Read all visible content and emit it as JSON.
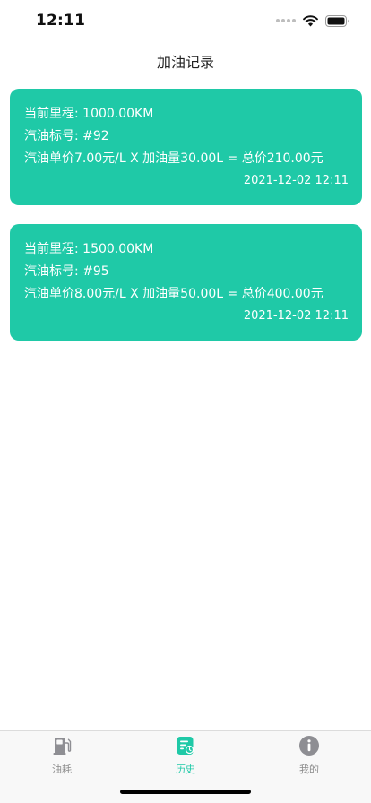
{
  "status_bar": {
    "time": "12:11"
  },
  "nav": {
    "title": "加油记录"
  },
  "records": [
    {
      "mileage": "当前里程: 1000.00KM",
      "fuel_grade": "汽油标号: #92",
      "calc": "汽油单价7.00元/L X 加油量30.00L = 总价210.00元",
      "time": "2021-12-02 12:11"
    },
    {
      "mileage": "当前里程: 1500.00KM",
      "fuel_grade": "汽油标号: #95",
      "calc": "汽油单价8.00元/L X 加油量50.00L = 总价400.00元",
      "time": "2021-12-02 12:11"
    }
  ],
  "tabs": [
    {
      "label": "油耗",
      "icon": "fuel-pump-icon",
      "active": false
    },
    {
      "label": "历史",
      "icon": "history-icon",
      "active": true
    },
    {
      "label": "我的",
      "icon": "info-icon",
      "active": false
    }
  ],
  "colors": {
    "accent": "#1fc9a7",
    "card_text": "#ffffff",
    "tab_inactive": "#8a8a8a"
  }
}
